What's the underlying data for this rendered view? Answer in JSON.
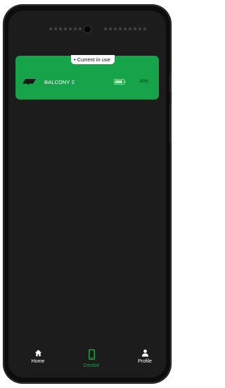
{
  "device_card": {
    "badge_label": "• Current in use",
    "name": "BALCONY 2",
    "battery_level": "90%",
    "battery_fraction": 0.9
  },
  "bottom_nav": {
    "items": [
      {
        "label": "Home",
        "icon": "home-icon",
        "active": false
      },
      {
        "label": "Device",
        "icon": "phone-icon",
        "active": true
      },
      {
        "label": "Profile",
        "icon": "user-icon",
        "active": false
      }
    ]
  },
  "colors": {
    "accent": "#16a34a",
    "screen_background": "#1c1c1c"
  }
}
